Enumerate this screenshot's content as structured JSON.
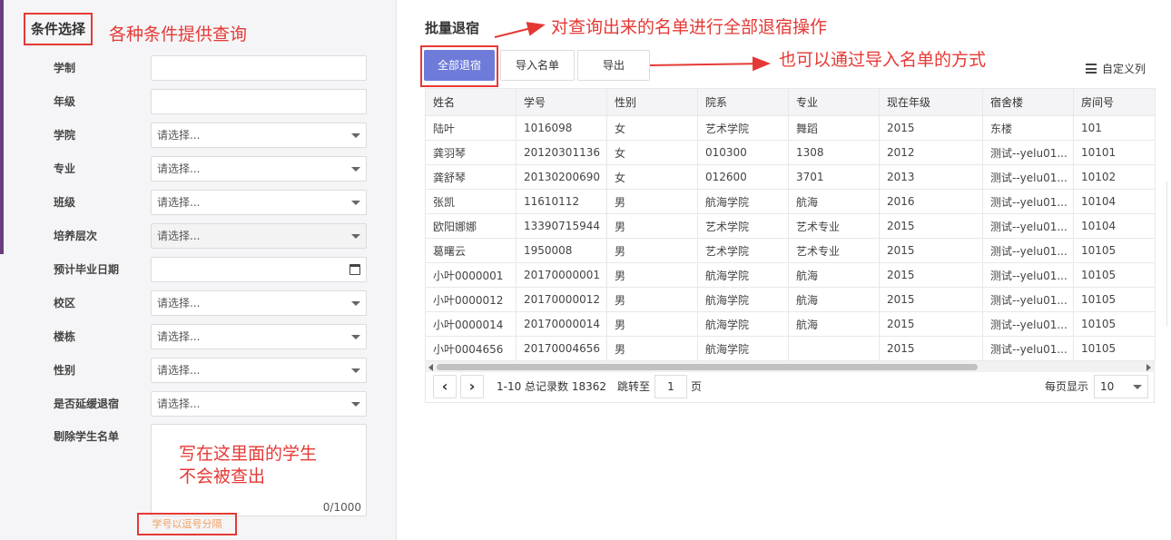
{
  "left_panel": {
    "section_title": "条件选择",
    "annotation_conditions": "各种条件提供查询",
    "fields": [
      {
        "label": "学制",
        "type": "text",
        "value": ""
      },
      {
        "label": "年级",
        "type": "text",
        "value": ""
      },
      {
        "label": "学院",
        "type": "select",
        "value": "请选择..."
      },
      {
        "label": "专业",
        "type": "select",
        "value": "请选择..."
      },
      {
        "label": "班级",
        "type": "select",
        "value": "请选择..."
      },
      {
        "label": "培养层次",
        "type": "select",
        "value": "请选择...",
        "disabled": true
      },
      {
        "label": "预计毕业日期",
        "type": "date",
        "value": ""
      },
      {
        "label": "校区",
        "type": "select",
        "value": "请选择..."
      },
      {
        "label": "楼栋",
        "type": "select",
        "value": "请选择..."
      },
      {
        "label": "性别",
        "type": "select",
        "value": "请选择..."
      },
      {
        "label": "是否延缓退宿",
        "type": "select",
        "value": "请选择..."
      }
    ],
    "exclude_field": {
      "label": "剔除学生名单",
      "annotation": "写在这里面的学生\n不会被查出",
      "counter": "0/1000",
      "hint": "学号以逗号分隔"
    }
  },
  "right_panel": {
    "title": "批量退宿",
    "annotation_batch": "对查询出来的名单进行全部退宿操作",
    "annotation_import": "也可以通过导入名单的方式",
    "buttons": {
      "checkout_all": "全部退宿",
      "import_list": "导入名单",
      "export": "导出"
    },
    "custom_columns": "自定义列",
    "columns": [
      "姓名",
      "学号",
      "性别",
      "院系",
      "专业",
      "现在年级",
      "宿舍楼",
      "房间号"
    ],
    "rows": [
      [
        "陆叶",
        "1016098",
        "女",
        "艺术学院",
        "舞蹈",
        "2015",
        "东楼",
        "101"
      ],
      [
        "龚羽琴",
        "20120301136",
        "女",
        "010300",
        "1308",
        "2012",
        "测试--yelu01...",
        "10101"
      ],
      [
        "龚舒琴",
        "20130200690",
        "女",
        "012600",
        "3701",
        "2013",
        "测试--yelu01...",
        "10102"
      ],
      [
        "张凯",
        "11610112",
        "男",
        "航海学院",
        "航海",
        "2016",
        "测试--yelu01...",
        "10104"
      ],
      [
        "欧阳娜娜",
        "13390715944",
        "男",
        "艺术学院",
        "艺术专业",
        "2015",
        "测试--yelu01...",
        "10104"
      ],
      [
        "葛曙云",
        "1950008",
        "男",
        "艺术学院",
        "艺术专业",
        "2015",
        "测试--yelu01...",
        "10105"
      ],
      [
        "小叶0000001",
        "20170000001",
        "男",
        "航海学院",
        "航海",
        "2015",
        "测试--yelu01...",
        "10105"
      ],
      [
        "小叶0000012",
        "20170000012",
        "男",
        "航海学院",
        "航海",
        "2015",
        "测试--yelu01...",
        "10105"
      ],
      [
        "小叶0000014",
        "20170000014",
        "男",
        "航海学院",
        "航海",
        "2015",
        "测试--yelu01...",
        "10105"
      ],
      [
        "小叶0004656",
        "20170004656",
        "男",
        "航海学院",
        "",
        "2015",
        "测试--yelu01...",
        "10105"
      ]
    ],
    "pager": {
      "prev_icon": "chevron-left-icon",
      "next_icon": "chevron-right-icon",
      "summary": "1-10 总记录数 18362",
      "jump_label": "跳转至",
      "page_value": "1",
      "page_suffix": "页",
      "page_size_label": "每页显示",
      "page_size": "10"
    }
  },
  "colors": {
    "annotation_red": "#e53935",
    "primary_button": "#6f7bd9",
    "sidebar_accent": "#6b3d7e",
    "hint_orange": "#f0a060"
  }
}
